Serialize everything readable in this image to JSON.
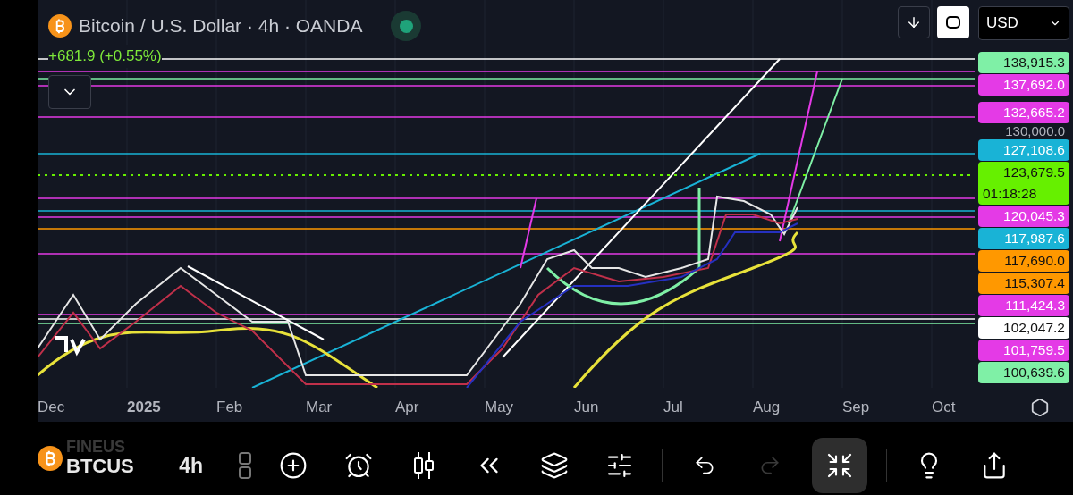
{
  "header": {
    "title": "Bitcoin / U.S. Dollar · 4h · OANDA",
    "status": {
      "color": "#1fa37a"
    },
    "change": "+681.9 (+0.55%)"
  },
  "currency": {
    "value": "USD"
  },
  "price_labels": [
    {
      "kind": "tag",
      "text": "138,915.3",
      "color": "#7ff0a6"
    },
    {
      "kind": "tag",
      "text": "137,692.0",
      "color": "#e43ae6"
    },
    {
      "kind": "tag",
      "text": "132,665.2",
      "color": "#e43ae6"
    },
    {
      "kind": "plain",
      "text": "130,000.0"
    },
    {
      "kind": "tag",
      "text": "127,108.6",
      "color": "#19b3d6"
    },
    {
      "kind": "tag",
      "text": "123,679.5",
      "sub": "01:18:28",
      "color": "#66f000"
    },
    {
      "kind": "tag",
      "text": "120,045.3",
      "color": "#e43ae6"
    },
    {
      "kind": "tag",
      "text": "117,987.6",
      "color": "#19b3d6"
    },
    {
      "kind": "tag",
      "text": "117,690.0",
      "color": "#ff9800"
    },
    {
      "kind": "tag",
      "text": "115,307.4",
      "color": "#ff9800"
    },
    {
      "kind": "tag",
      "text": "111,424.3",
      "color": "#e43ae6"
    },
    {
      "kind": "tag",
      "text": "102,047.2",
      "color": "#ffffff"
    },
    {
      "kind": "tag",
      "text": "101,759.5",
      "color": "#e43ae6"
    },
    {
      "kind": "tag",
      "text": "100,639.6",
      "color": "#7ff0a6"
    }
  ],
  "time_axis": [
    {
      "label": "Dec",
      "bold": false
    },
    {
      "label": "2025",
      "bold": true
    },
    {
      "label": "Feb",
      "bold": false
    },
    {
      "label": "Mar",
      "bold": false
    },
    {
      "label": "Apr",
      "bold": false
    },
    {
      "label": "May",
      "bold": false
    },
    {
      "label": "Jun",
      "bold": false
    },
    {
      "label": "Jul",
      "bold": false
    },
    {
      "label": "Aug",
      "bold": false
    },
    {
      "label": "Sep",
      "bold": false
    },
    {
      "label": "Oct",
      "bold": false
    }
  ],
  "toolbar": {
    "symbol_above": "FINEUS",
    "symbol": "BTCUS",
    "interval": "4h",
    "redo_disabled": true,
    "collapse_selected": true
  }
}
